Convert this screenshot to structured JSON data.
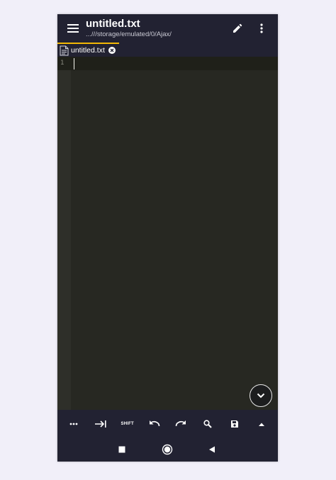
{
  "appbar": {
    "title": "untitled.txt",
    "subtitle": "...///storage/emulated/0/Ajax/",
    "icons": {
      "menu": "hamburger-menu-icon",
      "edit": "pencil-icon",
      "more": "vertical-dots-icon"
    }
  },
  "tabs": [
    {
      "label": "untitled.txt",
      "icon": "text-file-icon",
      "active": true
    }
  ],
  "editor": {
    "line_numbers": [
      "1"
    ],
    "content": ""
  },
  "toolbar": {
    "items": [
      {
        "name": "more-symbols",
        "icon": "horizontal-dots-icon"
      },
      {
        "name": "tab",
        "icon": "tab-arrow-icon"
      },
      {
        "name": "shift",
        "label": "SHIFT"
      },
      {
        "name": "undo",
        "icon": "undo-icon"
      },
      {
        "name": "redo",
        "icon": "redo-icon"
      },
      {
        "name": "search",
        "icon": "search-icon"
      },
      {
        "name": "save",
        "icon": "save-icon"
      },
      {
        "name": "expand",
        "icon": "caret-up-icon"
      }
    ]
  },
  "colors": {
    "bar_background": "#222232",
    "editor_background": "#272822",
    "tab_indicator": "#f2b705",
    "page_background": "#f1eff9"
  }
}
